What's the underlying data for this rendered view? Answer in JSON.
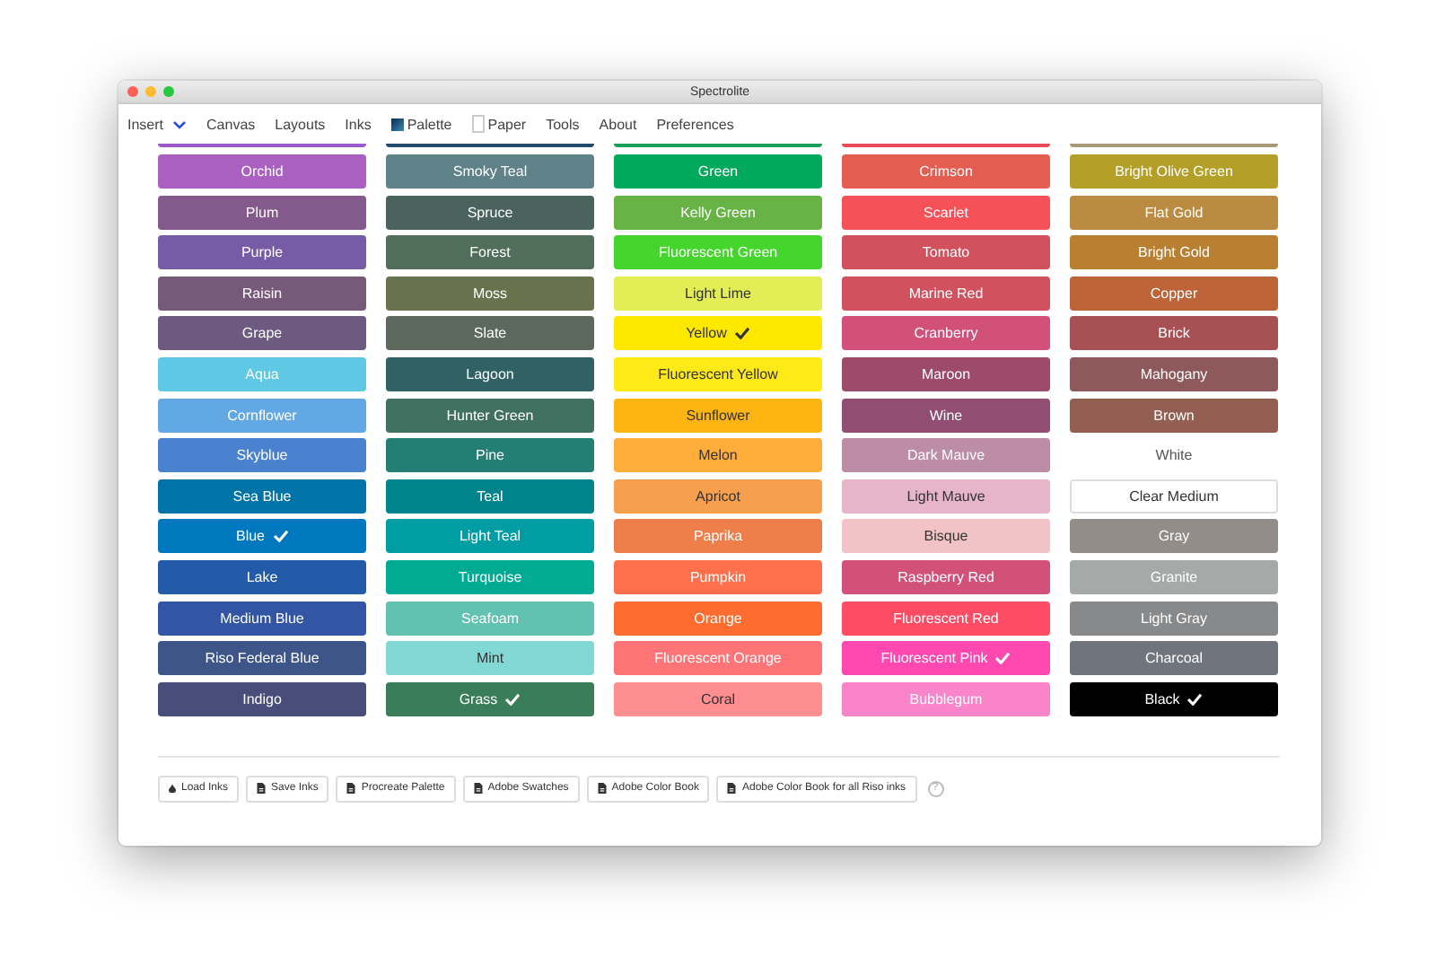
{
  "window": {
    "title": "Spectrolite"
  },
  "menu": [
    {
      "label": "Insert",
      "kind": "dropdown"
    },
    {
      "label": "Canvas",
      "kind": "plain"
    },
    {
      "label": "Layouts",
      "kind": "plain"
    },
    {
      "label": "Inks",
      "kind": "plain"
    },
    {
      "label": "Palette",
      "kind": "palette"
    },
    {
      "label": "Paper",
      "kind": "paper"
    },
    {
      "label": "Tools",
      "kind": "plain"
    },
    {
      "label": "About",
      "kind": "plain"
    },
    {
      "label": "Preferences",
      "kind": "plain"
    }
  ],
  "partial_row": [
    {
      "color": "#9b59c9"
    },
    {
      "color": "#244a6a"
    },
    {
      "color": "#1aa05a"
    },
    {
      "color": "#e84a5a"
    },
    {
      "color": "#a89a78"
    }
  ],
  "columns": [
    [
      {
        "name": "Orchid",
        "color": "#aa60c0",
        "kind": "fill",
        "selected": false
      },
      {
        "name": "Plum",
        "color": "#845a8c",
        "kind": "fill",
        "selected": false
      },
      {
        "name": "Purple",
        "color": "#765ba6",
        "kind": "fill",
        "selected": false
      },
      {
        "name": "Raisin",
        "color": "#775a7a",
        "kind": "fill",
        "selected": false
      },
      {
        "name": "Grape",
        "color": "#6d5a80",
        "kind": "fill",
        "selected": false
      },
      {
        "name": "Aqua",
        "color": "#5ec8e5",
        "kind": "fill",
        "selected": false
      },
      {
        "name": "Cornflower",
        "color": "#62a8e5",
        "kind": "fill",
        "selected": false
      },
      {
        "name": "Skyblue",
        "color": "#4a82d0",
        "kind": "fill",
        "selected": false
      },
      {
        "name": "Sea Blue",
        "color": "#0074a8",
        "kind": "fill",
        "selected": false
      },
      {
        "name": "Blue",
        "color": "#0078bf",
        "kind": "fill",
        "selected": true
      },
      {
        "name": "Lake",
        "color": "#235ba8",
        "kind": "fill",
        "selected": false
      },
      {
        "name": "Medium Blue",
        "color": "#3255a4",
        "kind": "fill",
        "selected": false
      },
      {
        "name": "Riso Federal Blue",
        "color": "#3d5588",
        "kind": "fill",
        "selected": false
      },
      {
        "name": "Indigo",
        "color": "#484d7a",
        "kind": "fill",
        "selected": false
      }
    ],
    [
      {
        "name": "Smoky Teal",
        "color": "#5f8289",
        "kind": "fill",
        "selected": false
      },
      {
        "name": "Spruce",
        "color": "#4a635d",
        "kind": "fill",
        "selected": false
      },
      {
        "name": "Forest",
        "color": "#516e5a",
        "kind": "fill",
        "selected": false
      },
      {
        "name": "Moss",
        "color": "#68724d",
        "kind": "fill",
        "selected": false
      },
      {
        "name": "Slate",
        "color": "#5e695e",
        "kind": "fill",
        "selected": false
      },
      {
        "name": "Lagoon",
        "color": "#2f6165",
        "kind": "fill",
        "selected": false
      },
      {
        "name": "Hunter Green",
        "color": "#407060",
        "kind": "fill",
        "selected": false
      },
      {
        "name": "Pine",
        "color": "#237e74",
        "kind": "fill",
        "selected": false
      },
      {
        "name": "Teal",
        "color": "#00838a",
        "kind": "fill",
        "selected": false
      },
      {
        "name": "Light Teal",
        "color": "#009da5",
        "kind": "fill",
        "selected": false
      },
      {
        "name": "Turquoise",
        "color": "#00aa93",
        "kind": "fill",
        "selected": false
      },
      {
        "name": "Seafoam",
        "color": "#62c2b1",
        "kind": "fill",
        "selected": false
      },
      {
        "name": "Mint",
        "color": "#82d8d5",
        "kind": "fill",
        "selected": false
      },
      {
        "name": "Grass",
        "color": "#397e58",
        "kind": "fill",
        "selected": true
      }
    ],
    [
      {
        "name": "Green",
        "color": "#00a95c",
        "kind": "fill",
        "selected": false
      },
      {
        "name": "Kelly Green",
        "color": "#67b346",
        "kind": "fill",
        "selected": false
      },
      {
        "name": "Fluorescent Green",
        "color": "#44d62c",
        "kind": "fill",
        "selected": false
      },
      {
        "name": "Light Lime",
        "color": "#e3ed55",
        "kind": "fill",
        "selected": false
      },
      {
        "name": "Yellow",
        "color": "#ffe800",
        "kind": "fill",
        "selected": true
      },
      {
        "name": "Fluorescent Yellow",
        "color": "#ffe916",
        "kind": "fill",
        "selected": false
      },
      {
        "name": "Sunflower",
        "color": "#ffb511",
        "kind": "fill",
        "selected": false
      },
      {
        "name": "Melon",
        "color": "#ffae3b",
        "kind": "fill",
        "selected": false
      },
      {
        "name": "Apricot",
        "color": "#f6a04d",
        "kind": "fill",
        "selected": false
      },
      {
        "name": "Paprika",
        "color": "#ee7f4b",
        "kind": "fill",
        "selected": false
      },
      {
        "name": "Pumpkin",
        "color": "#ff6f4c",
        "kind": "fill",
        "selected": false
      },
      {
        "name": "Orange",
        "color": "#ff6c2f",
        "kind": "fill",
        "selected": false
      },
      {
        "name": "Fluorescent Orange",
        "color": "#ff7477",
        "kind": "fill",
        "selected": false
      },
      {
        "name": "Coral",
        "color": "#ff8e91",
        "kind": "fill",
        "selected": false
      }
    ],
    [
      {
        "name": "Crimson",
        "color": "#e45d50",
        "kind": "fill",
        "selected": false
      },
      {
        "name": "Scarlet",
        "color": "#f65058",
        "kind": "fill",
        "selected": false
      },
      {
        "name": "Tomato",
        "color": "#d2515e",
        "kind": "fill",
        "selected": false
      },
      {
        "name": "Marine Red",
        "color": "#d2515e",
        "kind": "fill",
        "selected": false
      },
      {
        "name": "Cranberry",
        "color": "#d1517a",
        "kind": "fill",
        "selected": false
      },
      {
        "name": "Maroon",
        "color": "#9e4a6a",
        "kind": "fill",
        "selected": false
      },
      {
        "name": "Wine",
        "color": "#914e72",
        "kind": "fill",
        "selected": false
      },
      {
        "name": "Dark Mauve",
        "color": "#bd8ca6",
        "kind": "fill",
        "selected": false
      },
      {
        "name": "Light Mauve",
        "color": "#e6b5c9",
        "kind": "fill",
        "selected": false
      },
      {
        "name": "Bisque",
        "color": "#f2c3c6",
        "kind": "fill",
        "selected": false
      },
      {
        "name": "Raspberry Red",
        "color": "#d1517a",
        "kind": "fill",
        "selected": false
      },
      {
        "name": "Fluorescent Red",
        "color": "#ff4c65",
        "kind": "fill",
        "selected": false
      },
      {
        "name": "Fluorescent Pink",
        "color": "#ff48b0",
        "kind": "fill",
        "selected": true
      },
      {
        "name": "Bubblegum",
        "color": "#f984ca",
        "kind": "fill",
        "selected": false
      }
    ],
    [
      {
        "name": "Bright Olive Green",
        "color": "#b49f29",
        "kind": "fill",
        "selected": false
      },
      {
        "name": "Flat Gold",
        "color": "#bb8b41",
        "kind": "fill",
        "selected": false
      },
      {
        "name": "Bright Gold",
        "color": "#ba8032",
        "kind": "fill",
        "selected": false
      },
      {
        "name": "Copper",
        "color": "#bd6439",
        "kind": "fill",
        "selected": false
      },
      {
        "name": "Brick",
        "color": "#a75154",
        "kind": "fill",
        "selected": false
      },
      {
        "name": "Mahogany",
        "color": "#8e595a",
        "kind": "fill",
        "selected": false
      },
      {
        "name": "Brown",
        "color": "#925f52",
        "kind": "fill",
        "selected": false
      },
      {
        "name": "White",
        "color": "#ffffff",
        "kind": "none",
        "selected": false
      },
      {
        "name": "Clear Medium",
        "color": "#ffffff",
        "kind": "outline",
        "selected": false
      },
      {
        "name": "Gray",
        "color": "#928d88",
        "kind": "fill",
        "selected": false
      },
      {
        "name": "Granite",
        "color": "#a5aaa8",
        "kind": "fill",
        "selected": false
      },
      {
        "name": "Light Gray",
        "color": "#88898a",
        "kind": "fill",
        "selected": false
      },
      {
        "name": "Charcoal",
        "color": "#70747c",
        "kind": "fill",
        "selected": false
      },
      {
        "name": "Black",
        "color": "#000000",
        "kind": "fill",
        "selected": true
      }
    ]
  ],
  "actions": [
    {
      "label": "Load Inks",
      "kind": "load"
    },
    {
      "label": "Save Inks",
      "kind": "export"
    },
    {
      "label": "Procreate Palette",
      "kind": "export"
    },
    {
      "label": "Adobe Swatches",
      "kind": "export"
    },
    {
      "label": "Adobe Color Book",
      "kind": "export"
    },
    {
      "label": "Adobe Color Book for all Riso inks",
      "kind": "export"
    }
  ],
  "help": {
    "label": "?"
  }
}
